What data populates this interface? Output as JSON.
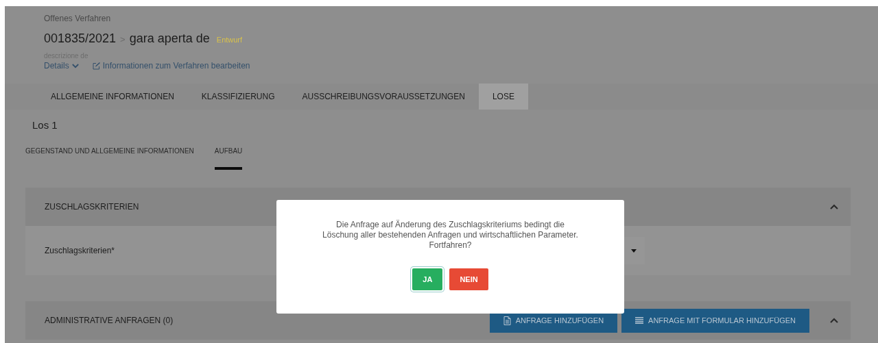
{
  "header": {
    "procedure_type": "Offenes Verfahren",
    "number": "001835/2021",
    "separator": ">",
    "title": "gara aperta de",
    "status": "Entwurf",
    "description": "descrizione de",
    "details_link": "Details",
    "edit_link": "Informationen zum Verfahren bearbeiten"
  },
  "tabs": [
    {
      "label": "ALLGEMEINE INFORMATIONEN",
      "selected": false
    },
    {
      "label": "KLASSIFIZIERUNG",
      "selected": false
    },
    {
      "label": "AUSSCHREIBUNGSVORAUSSETZUNGEN",
      "selected": false
    },
    {
      "label": "LOSE",
      "selected": true
    }
  ],
  "lot_title": "Los 1",
  "subtabs": [
    {
      "label": "GEGENSTAND UND ALLGEMEINE INFORMATIONEN",
      "selected": false
    },
    {
      "label": "AUFBAU",
      "selected": true
    }
  ],
  "sections": [
    {
      "title": "ZUSCHLAGSKRITERIEN",
      "expanded": true,
      "field_label": "Zuschlagskriterien*"
    },
    {
      "title": "ADMINISTRATIVE ANFRAGEN (0)",
      "expanded": true,
      "buttons": [
        {
          "label": "ANFRAGE HINZUFÜGEN",
          "kind": "document"
        },
        {
          "label": "ANFRAGE MIT FORMULAR HINZUFÜGEN",
          "kind": "list"
        }
      ]
    }
  ],
  "dialog": {
    "message": "Die Anfrage auf Änderung des Zuschlagskriteriums bedingt die Löschung aller bestehenden Anfragen und wirtschaftlichen Parameter. Fortfahren?",
    "buttons": [
      {
        "label": "JA",
        "kind": "confirm"
      },
      {
        "label": "NEIN",
        "kind": "cancel"
      }
    ]
  }
}
